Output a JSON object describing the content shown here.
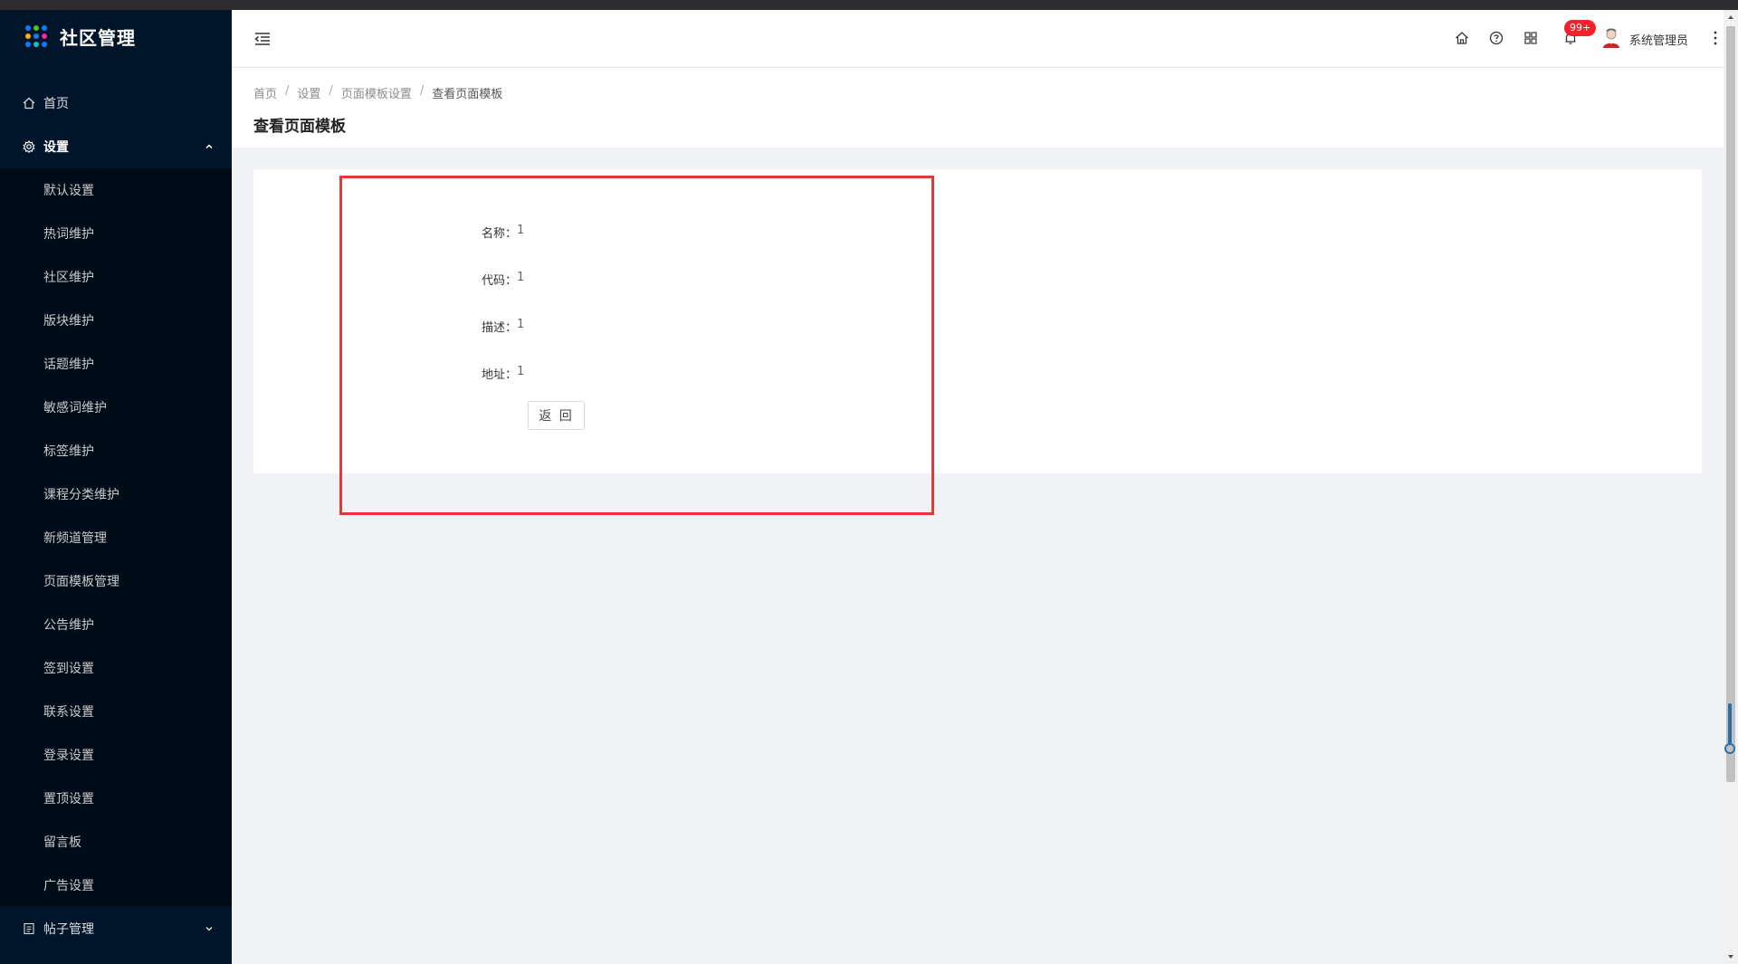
{
  "app": {
    "title": "社区管理"
  },
  "sidebar": {
    "home": "首页",
    "settings": "设置",
    "sub_items": [
      "默认设置",
      "热词维护",
      "社区维护",
      "版块维护",
      "话题维护",
      "敏感词维护",
      "标签维护",
      "课程分类维护",
      "新频道管理",
      "页面模板管理",
      "公告维护",
      "签到设置",
      "联系设置",
      "登录设置",
      "置顶设置",
      "留言板",
      "广告设置"
    ],
    "posts": "帖子管理"
  },
  "header": {
    "notification_badge": "99+",
    "user_name": "系统管理员",
    "icons": [
      "home-icon",
      "help-icon",
      "apps-icon",
      "bell-icon",
      "avatar",
      "more-icon"
    ]
  },
  "breadcrumb": [
    "首页",
    "设置",
    "页面模板设置",
    "查看页面模板"
  ],
  "page": {
    "title": "查看页面模板"
  },
  "detail": {
    "fields": [
      {
        "label": "名称：",
        "value": "1"
      },
      {
        "label": "代码：",
        "value": "1"
      },
      {
        "label": "描述：",
        "value": "1"
      },
      {
        "label": "地址：",
        "value": "1"
      }
    ],
    "back_button": "返 回"
  },
  "colors": {
    "sidebar_bg": "#001529",
    "submenu_bg": "#000c17",
    "highlight": "#e53935",
    "badge": "#f5222d"
  }
}
